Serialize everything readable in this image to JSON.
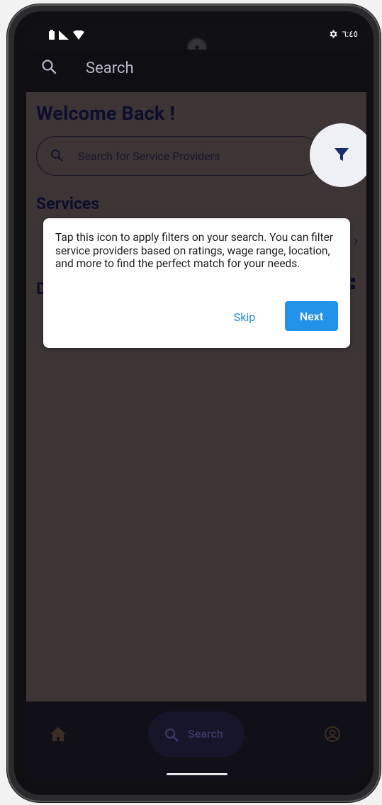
{
  "status_bar": {
    "time": "٦:٤٥",
    "icons": [
      "battery-icon",
      "signal-icon",
      "wifi-icon",
      "settings-icon"
    ]
  },
  "app_bar": {
    "title": "Search",
    "icon": "search-icon"
  },
  "home": {
    "welcome_text": "Welcome Back !",
    "search_placeholder": "Search for Service Providers",
    "filter_icon": "filter-funnel-icon",
    "services_title": "Services",
    "partial_section_letter": "D"
  },
  "coach_mark": {
    "text": "Tap this icon to apply filters on your search. You can filter service providers based on ratings, wage range, location, and more to find the perfect match for your needs.",
    "skip_label": "Skip",
    "next_label": "Next"
  },
  "bottom_nav": {
    "items": [
      {
        "label": "",
        "icon": "home-icon"
      },
      {
        "label": "Search",
        "icon": "search-icon"
      },
      {
        "label": "",
        "icon": "profile-icon"
      }
    ]
  },
  "colors": {
    "scrim": "#3d3535",
    "accent": "#2393ea",
    "heading": "#0d0e2b",
    "nav_bg": "#110f18"
  }
}
